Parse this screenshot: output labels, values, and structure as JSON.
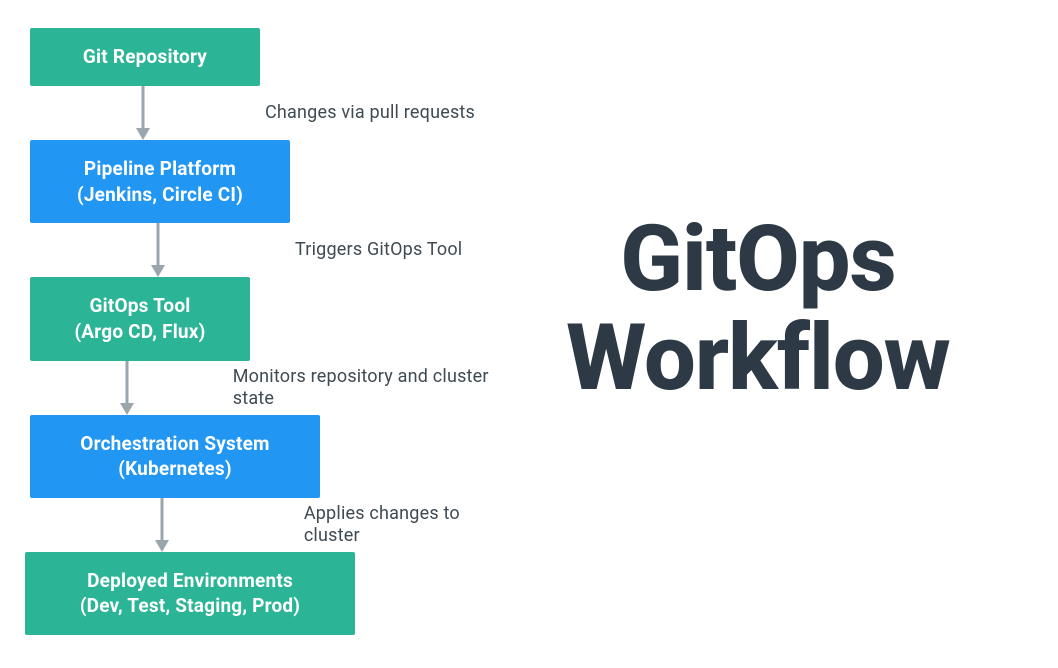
{
  "title": {
    "line1": "GitOps",
    "line2": "Workflow"
  },
  "flow": {
    "nodes": [
      {
        "line1": "Git Repository",
        "line2": ""
      },
      {
        "line1": "Pipeline Platform",
        "line2": "(Jenkins, Circle CI)"
      },
      {
        "line1": "GitOps Tool",
        "line2": "(Argo CD, Flux)"
      },
      {
        "line1": "Orchestration System",
        "line2": "(Kubernetes)"
      },
      {
        "line1": "Deployed Environments",
        "line2": "(Dev, Test, Staging, Prod)"
      }
    ],
    "connectors": [
      {
        "label": "Changes via pull requests"
      },
      {
        "label": "Triggers GitOps Tool"
      },
      {
        "label": "Monitors repository and cluster state"
      },
      {
        "label": "Applies changes to cluster"
      }
    ]
  }
}
